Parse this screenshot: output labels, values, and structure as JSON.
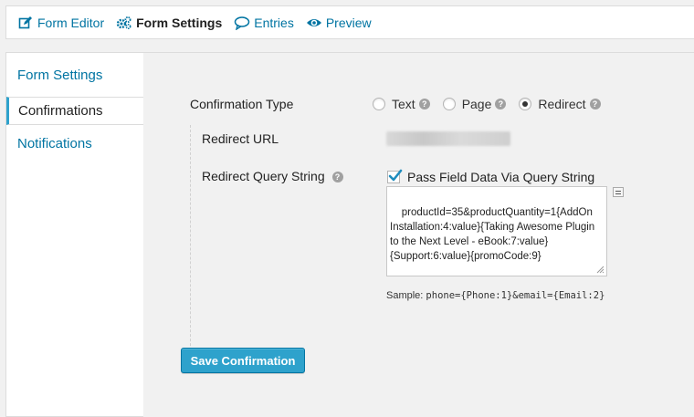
{
  "toolbar": {
    "items": [
      {
        "label": "Form Editor",
        "icon": "edit-icon"
      },
      {
        "label": "Form Settings",
        "icon": "gears-icon"
      },
      {
        "label": "Entries",
        "icon": "comment-icon"
      },
      {
        "label": "Preview",
        "icon": "eye-icon"
      }
    ],
    "active_index": 1
  },
  "sidebar": {
    "items": [
      {
        "label": "Form Settings"
      },
      {
        "label": "Confirmations"
      },
      {
        "label": "Notifications"
      }
    ],
    "active_index": 1
  },
  "confirmation": {
    "type_label": "Confirmation Type",
    "options": [
      {
        "label": "Text",
        "checked": false
      },
      {
        "label": "Page",
        "checked": false
      },
      {
        "label": "Redirect",
        "checked": true
      }
    ],
    "redirect_url_label": "Redirect URL",
    "query_string_label": "Redirect Query String",
    "pass_field_label": "Pass Field Data Via Query String",
    "pass_field_checked": true,
    "query_string_value": "productId=35&productQuantity=1{AddOn Installation:4:value}{Taking Awesome Plugin to the Next Level - eBook:7:value}{Support:6:value}{promoCode:9}",
    "sample_prefix": "Sample:",
    "sample_value": "phone={Phone:1}&email={Email:2}"
  },
  "save_button_label": "Save Confirmation",
  "colors": {
    "link": "#0074a2",
    "button": "#2ea2cc",
    "active_border": "#2ea2cc"
  }
}
